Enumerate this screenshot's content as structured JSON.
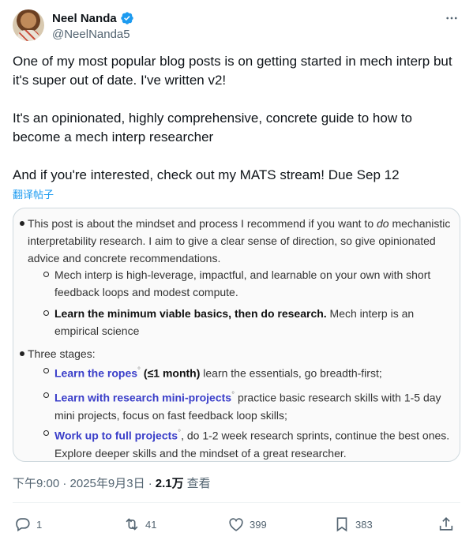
{
  "author": {
    "display_name": "Neel Nanda",
    "handle": "@NeelNanda5"
  },
  "tweet": {
    "lines": [
      "One of my most popular blog posts is on getting started in mech interp but it's super out of date. I've written v2!",
      "It's an opinionated, highly comprehensive, concrete guide to how to become a mech interp researcher",
      "And if you're interested, check out my MATS stream! Due Sep 12"
    ],
    "translate_label": "翻译帖子"
  },
  "image": {
    "intro_a": "This post is about the mindset and process I recommend if you want to ",
    "intro_em": "do",
    "intro_b": " mechanistic",
    "intro_l2": "interpretability research. I aim to give a clear sense of direction, so give opinionated",
    "intro_l3": "advice and concrete recommendations.",
    "sub1_l1": "Mech interp is high-leverage, impactful, and learnable on your own with short",
    "sub1_l2": "feedback loops and modest compute.",
    "sub2_bold": "Learn the minimum viable basics, then do research.",
    "sub2_rest": " Mech interp is an",
    "sub2_l2": "empirical science",
    "stages_label": "Three stages:",
    "stage1_link": "Learn the ropes",
    "stage1_paren": " (≤1 month)",
    "stage1_rest": " learn the essentials, go breadth-first;",
    "stage2_link": "Learn with research mini-projects",
    "stage2_rest": " practice basic research skills with 1-5 day",
    "stage2_l2": "mini projects, focus on fast feedback loop skills;",
    "stage3_link": "Work up to full projects",
    "stage3_rest": ", do 1-2 week research sprints, continue the best ones.",
    "stage3_l2": "Explore deeper skills and the mindset of a great researcher.",
    "degree_mark": "°"
  },
  "meta": {
    "time": "下午9:00 · 2025年9月3日 · ",
    "views": "2.1万",
    "views_label": "查看"
  },
  "actions": {
    "replies": "1",
    "reposts": "41",
    "likes": "399",
    "bookmarks": "383"
  },
  "colors": {
    "accent": "#1d9bf0",
    "link_in_image": "#3a3ec9",
    "secondary_text": "#536471"
  },
  "icons": [
    "verified-badge-icon",
    "more-icon",
    "reply-icon",
    "repost-icon",
    "like-icon",
    "bookmark-icon",
    "share-icon"
  ]
}
